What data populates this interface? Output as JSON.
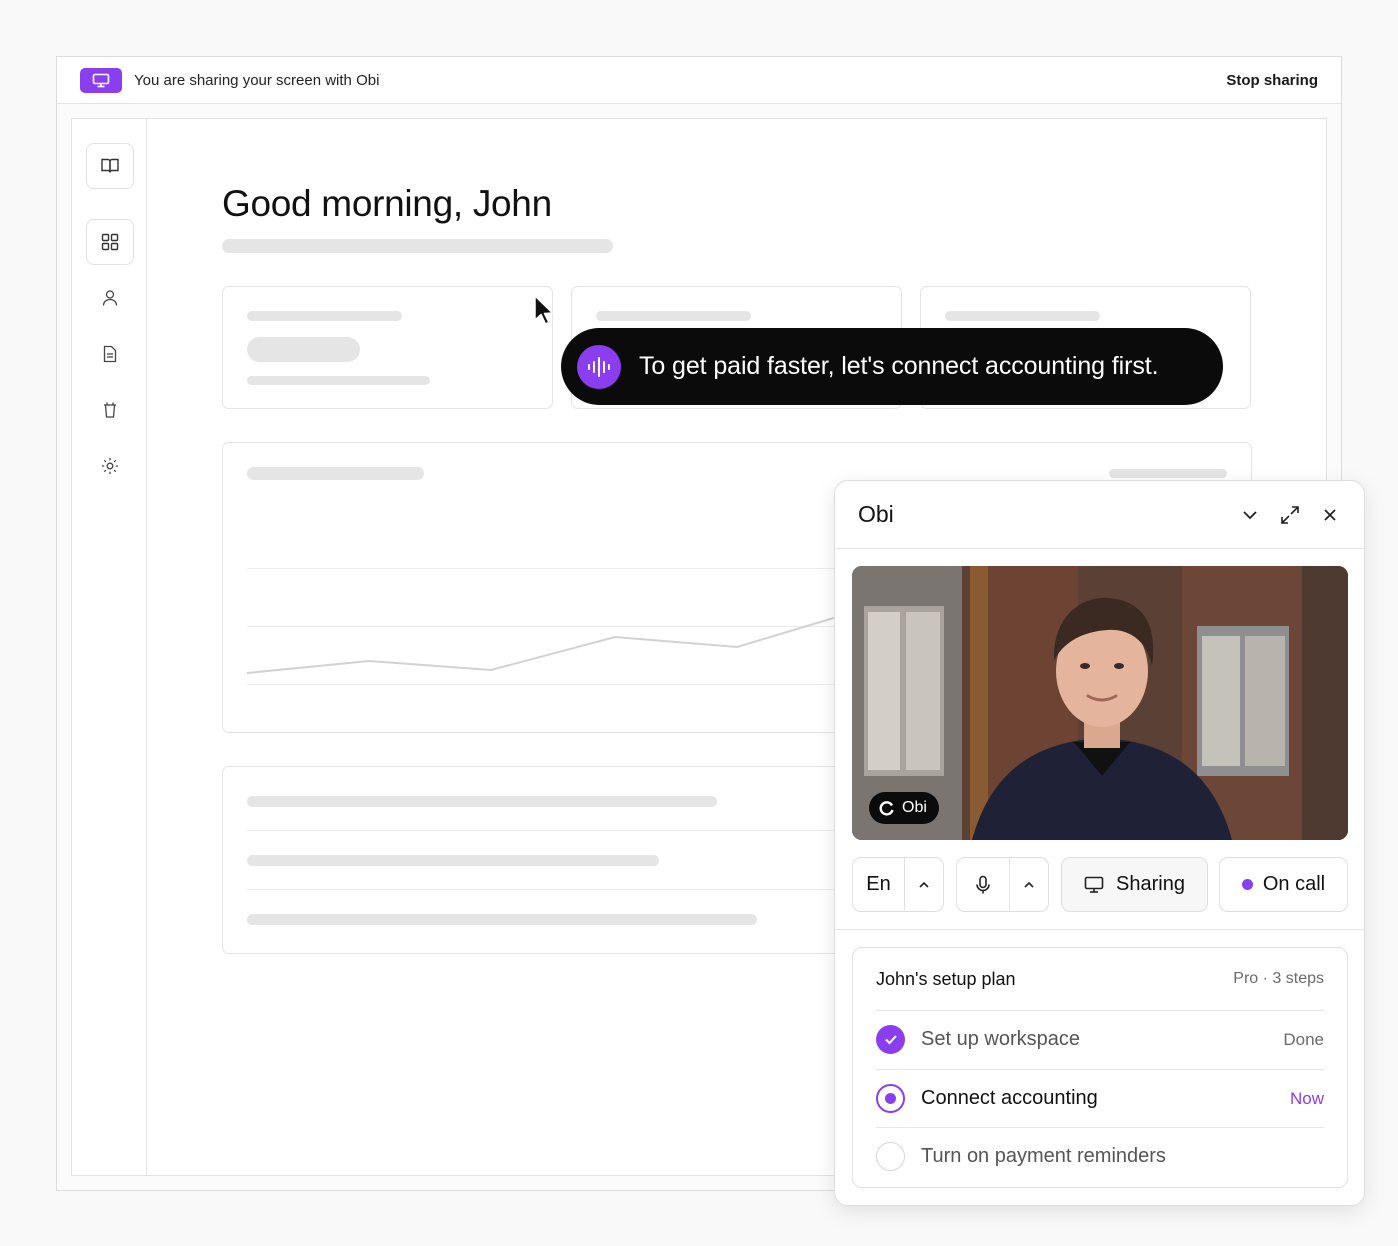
{
  "share_bar": {
    "message": "You are sharing your screen with Obi",
    "stop_label": "Stop sharing"
  },
  "sidebar": {
    "items": [
      {
        "icon": "book-open-icon",
        "selected": false
      },
      {
        "icon": "grid-icon",
        "selected": true
      },
      {
        "icon": "user-icon",
        "selected": false
      },
      {
        "icon": "document-icon",
        "selected": false
      },
      {
        "icon": "trash-icon",
        "selected": false
      },
      {
        "icon": "gear-icon",
        "selected": false
      }
    ]
  },
  "main": {
    "greeting": "Good morning, John"
  },
  "caption": {
    "text": "To get paid faster, let's connect accounting first."
  },
  "panel": {
    "title": "Obi",
    "video_tag": "Obi",
    "controls": {
      "language": "En",
      "sharing_label": "Sharing",
      "call_label": "On call"
    },
    "plan": {
      "title": "John's setup plan",
      "meta": "Pro · 3 steps",
      "steps": [
        {
          "label": "Set up workspace",
          "status": "Done",
          "state": "done"
        },
        {
          "label": "Connect accounting",
          "status": "Now",
          "state": "current"
        },
        {
          "label": "Turn on payment reminders",
          "status": "",
          "state": "todo"
        }
      ]
    }
  },
  "colors": {
    "accent": "#8b3df0",
    "caption_bg": "#0b0b0b",
    "skeleton": "#e5e5e5"
  }
}
